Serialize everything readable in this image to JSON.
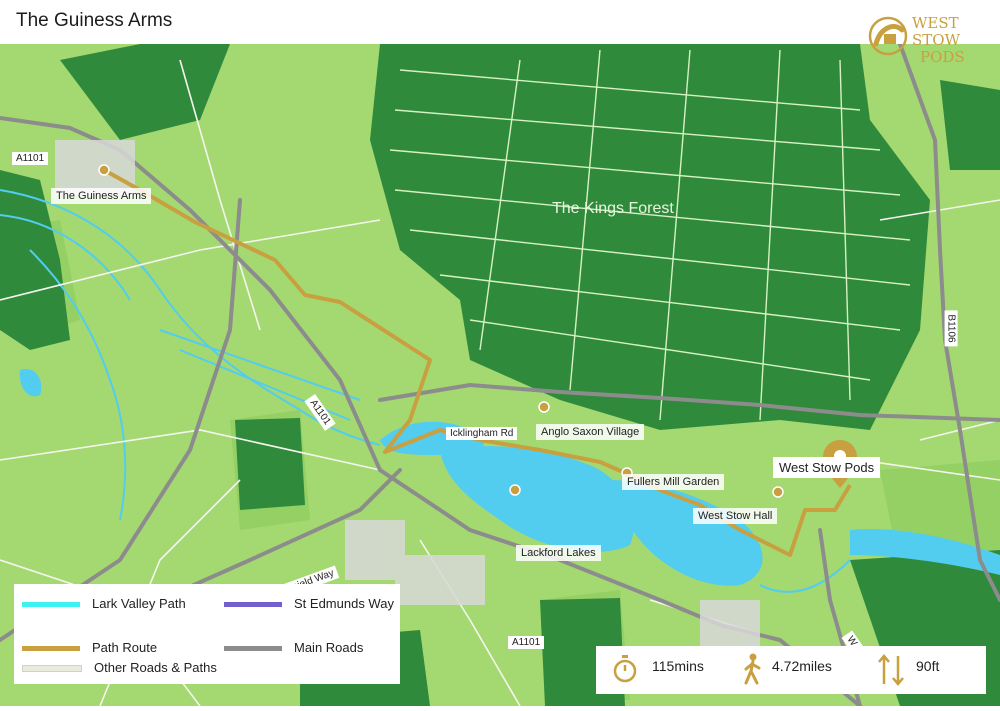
{
  "title": "The Guiness Arms",
  "logo": {
    "line1": "WEST",
    "line2": "STOW",
    "line3": "PODS"
  },
  "colors": {
    "field": "#a4d871",
    "forest": "#2f8a3c",
    "water": "#52cdef",
    "route": "#c9a040",
    "roads": "#8c8c8c",
    "lark": "#3ff2f2",
    "stedmunds": "#7060d0"
  },
  "map": {
    "forest_label": "The Kings Forest",
    "places": {
      "guiness": "The Guiness Arms",
      "anglo": "Anglo Saxon Village",
      "fullers": "Fullers Mill Garden",
      "westhall": "West Stow Hall",
      "lackford": "Lackford Lakes",
      "pods": "West Stow Pods"
    },
    "roads": {
      "a1101_top": "A1101",
      "a1101_mid": "A1101",
      "a1101_bottom": "A1101",
      "icklingham": "Icklingham Rd",
      "icknield": "Icknield Way",
      "b1106": "B1106",
      "wstow": "W Stow Road"
    }
  },
  "legend": [
    {
      "label": "Lark Valley Path",
      "color": "#3ff2f2"
    },
    {
      "label": "St Edmunds Way",
      "color": "#7060d0"
    },
    {
      "label": "Path Route",
      "color": "#c9a040"
    },
    {
      "label": "Main Roads",
      "color": "#8c8c8c"
    },
    {
      "label": "Other Roads & Paths",
      "color": "#e8ecdf"
    }
  ],
  "stats": {
    "time": "115mins",
    "distance": "4.72miles",
    "elevation": "90ft"
  }
}
